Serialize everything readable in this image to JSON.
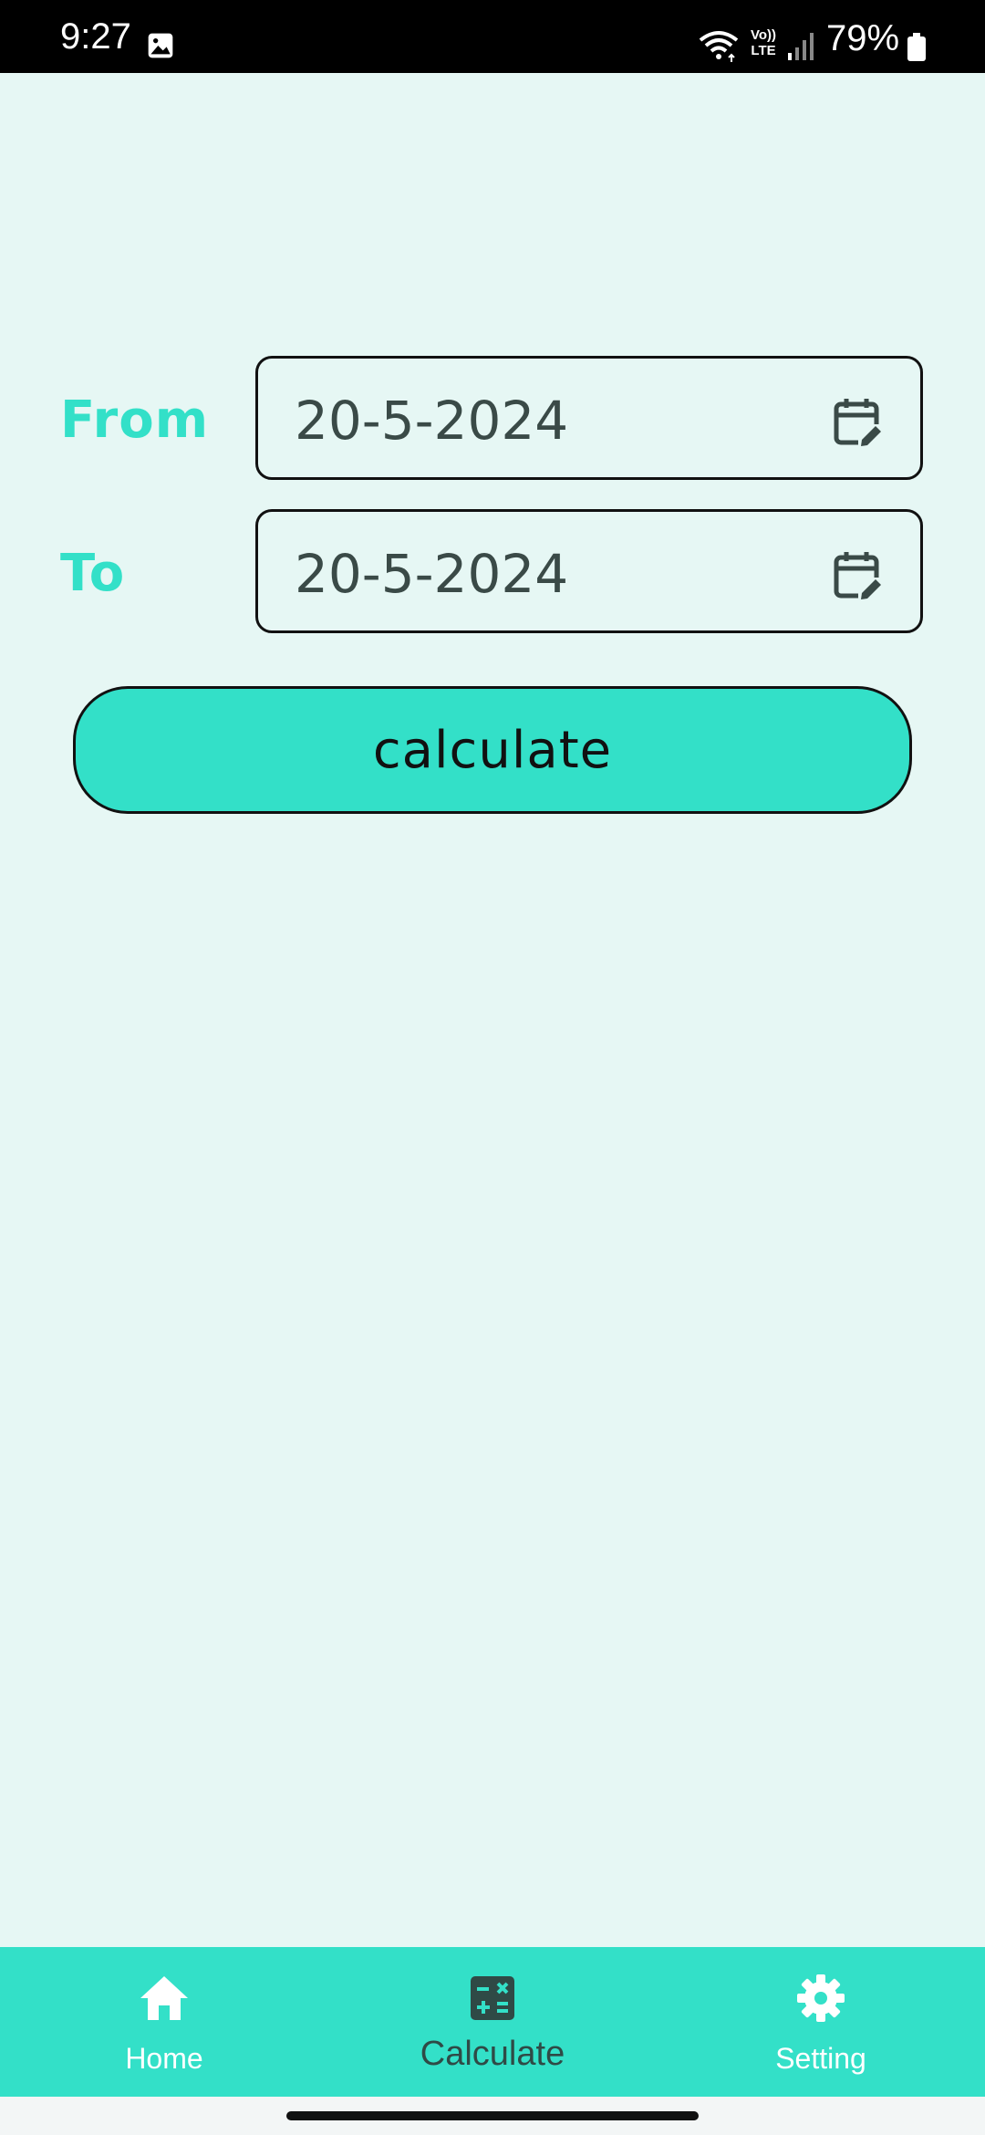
{
  "status_bar": {
    "time": "9:27",
    "battery": "79%",
    "network_top": "Vo))",
    "network_bottom": "LTE",
    "icons": [
      "gallery-icon",
      "wifi-icon",
      "signal-icon",
      "battery-icon"
    ]
  },
  "form": {
    "from_label": "From",
    "from_value": "20-5-2024",
    "to_label": "To",
    "to_value": "20-5-2024",
    "calculate_label": "calculate"
  },
  "bottom_nav": {
    "items": [
      {
        "label": "Home",
        "icon": "home-icon"
      },
      {
        "label": "Calculate",
        "icon": "calculator-icon",
        "selected": true
      },
      {
        "label": "Setting",
        "icon": "gear-icon"
      }
    ]
  },
  "colors": {
    "accent": "#33e0c8",
    "background": "#e6f7f4",
    "text_dark": "#3a4a47"
  }
}
